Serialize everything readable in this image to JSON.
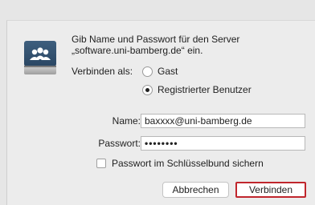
{
  "dialog": {
    "prompt_line1": "Gib Name und Passwort für den Server",
    "prompt_line2": "„software.uni-bamberg.de“ ein.",
    "connect_as_label": "Verbinden als:",
    "radio_guest": "Gast",
    "radio_registered": "Registrierter Benutzer",
    "selected_option": "Registrierter Benutzer",
    "name_label": "Name:",
    "name_value": "baxxxx@uni-bamberg.de",
    "password_label": "Passwort:",
    "password_value": "••••••••",
    "keychain_label": "Passwort im Schlüsselbund sichern",
    "keychain_checked": false,
    "cancel_label": "Abbrechen",
    "connect_label": "Verbinden",
    "server_icon": "network-server-icon",
    "highlight_color": "#c0262d"
  }
}
